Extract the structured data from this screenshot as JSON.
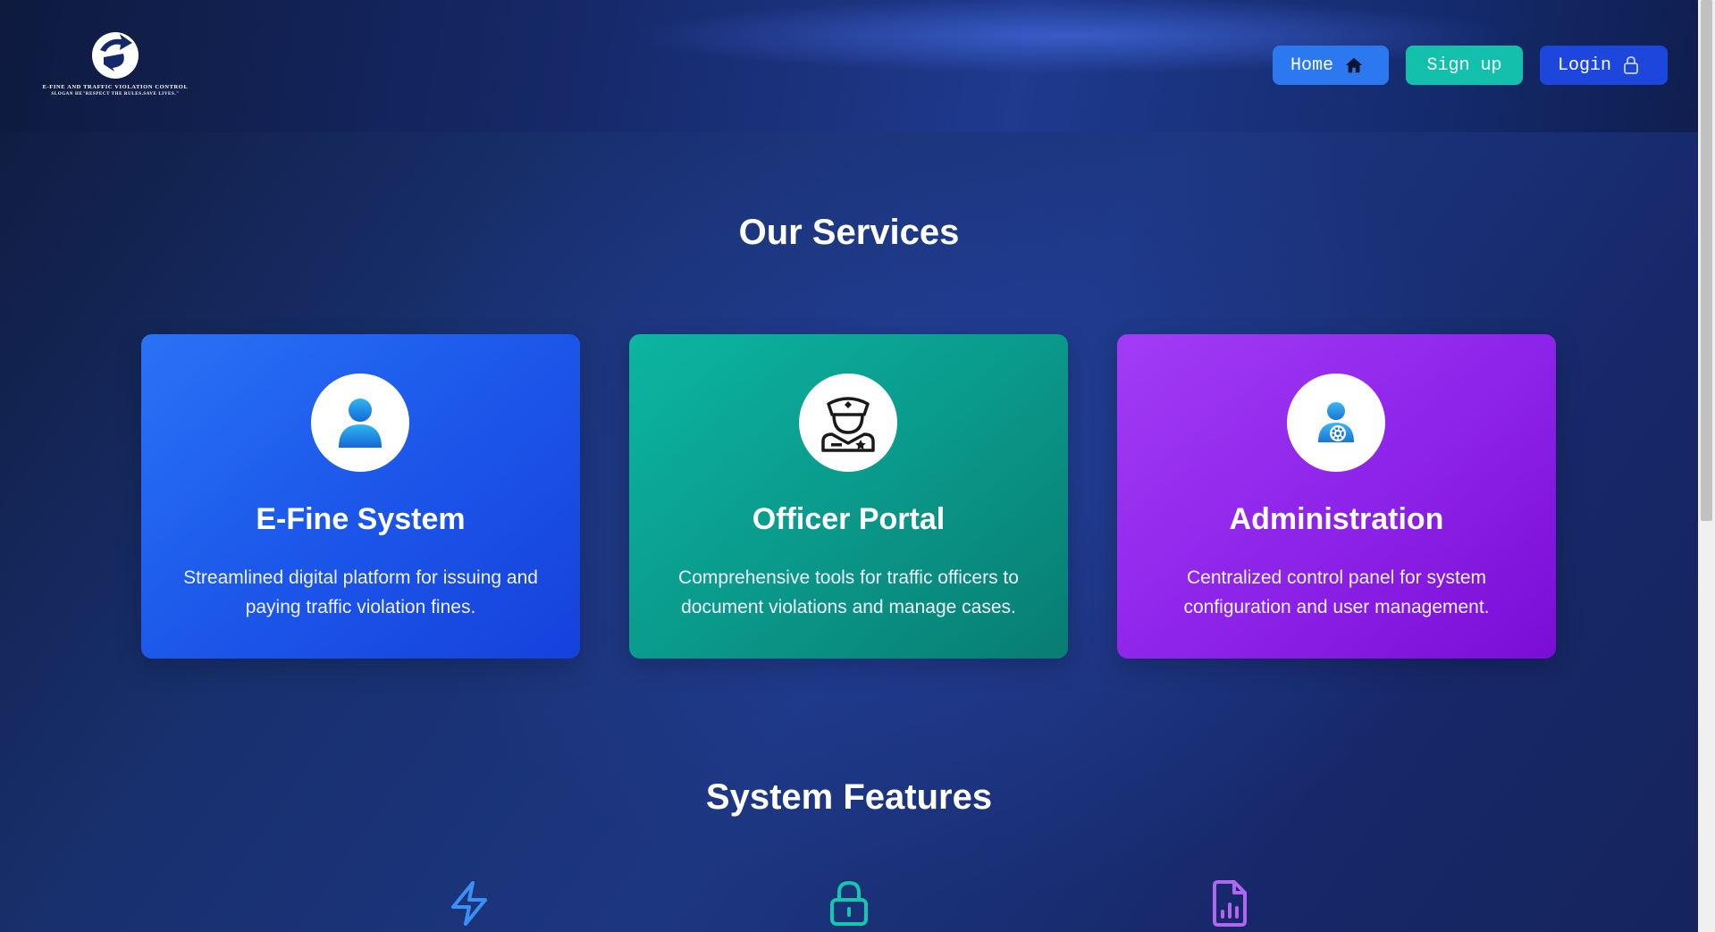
{
  "header": {
    "logo_title": "E-FINE AND TRAFFIC VIOLATION CONTROL",
    "logo_slogan": "SLOGAN HE\"RESPECT THE RULES.SAVE LIVES.\"",
    "nav": {
      "home": "Home",
      "signup": "Sign up",
      "login": "Login"
    }
  },
  "services": {
    "title": "Our Services",
    "cards": [
      {
        "title": "E-Fine System",
        "desc": "Streamlined digital platform for issuing and paying traffic violation fines.",
        "icon": "user-icon",
        "color": "#1c57ea"
      },
      {
        "title": "Officer Portal",
        "desc": "Comprehensive tools for traffic officers to document violations and manage cases.",
        "icon": "police-officer-icon",
        "color": "#0a9a8b"
      },
      {
        "title": "Administration",
        "desc": "Centralized control panel for system configuration and user management.",
        "icon": "admin-gear-icon",
        "color": "#8d22e8"
      }
    ]
  },
  "features": {
    "title": "System Features",
    "icons": [
      "lightning-icon",
      "lock-icon",
      "report-document-icon"
    ]
  }
}
